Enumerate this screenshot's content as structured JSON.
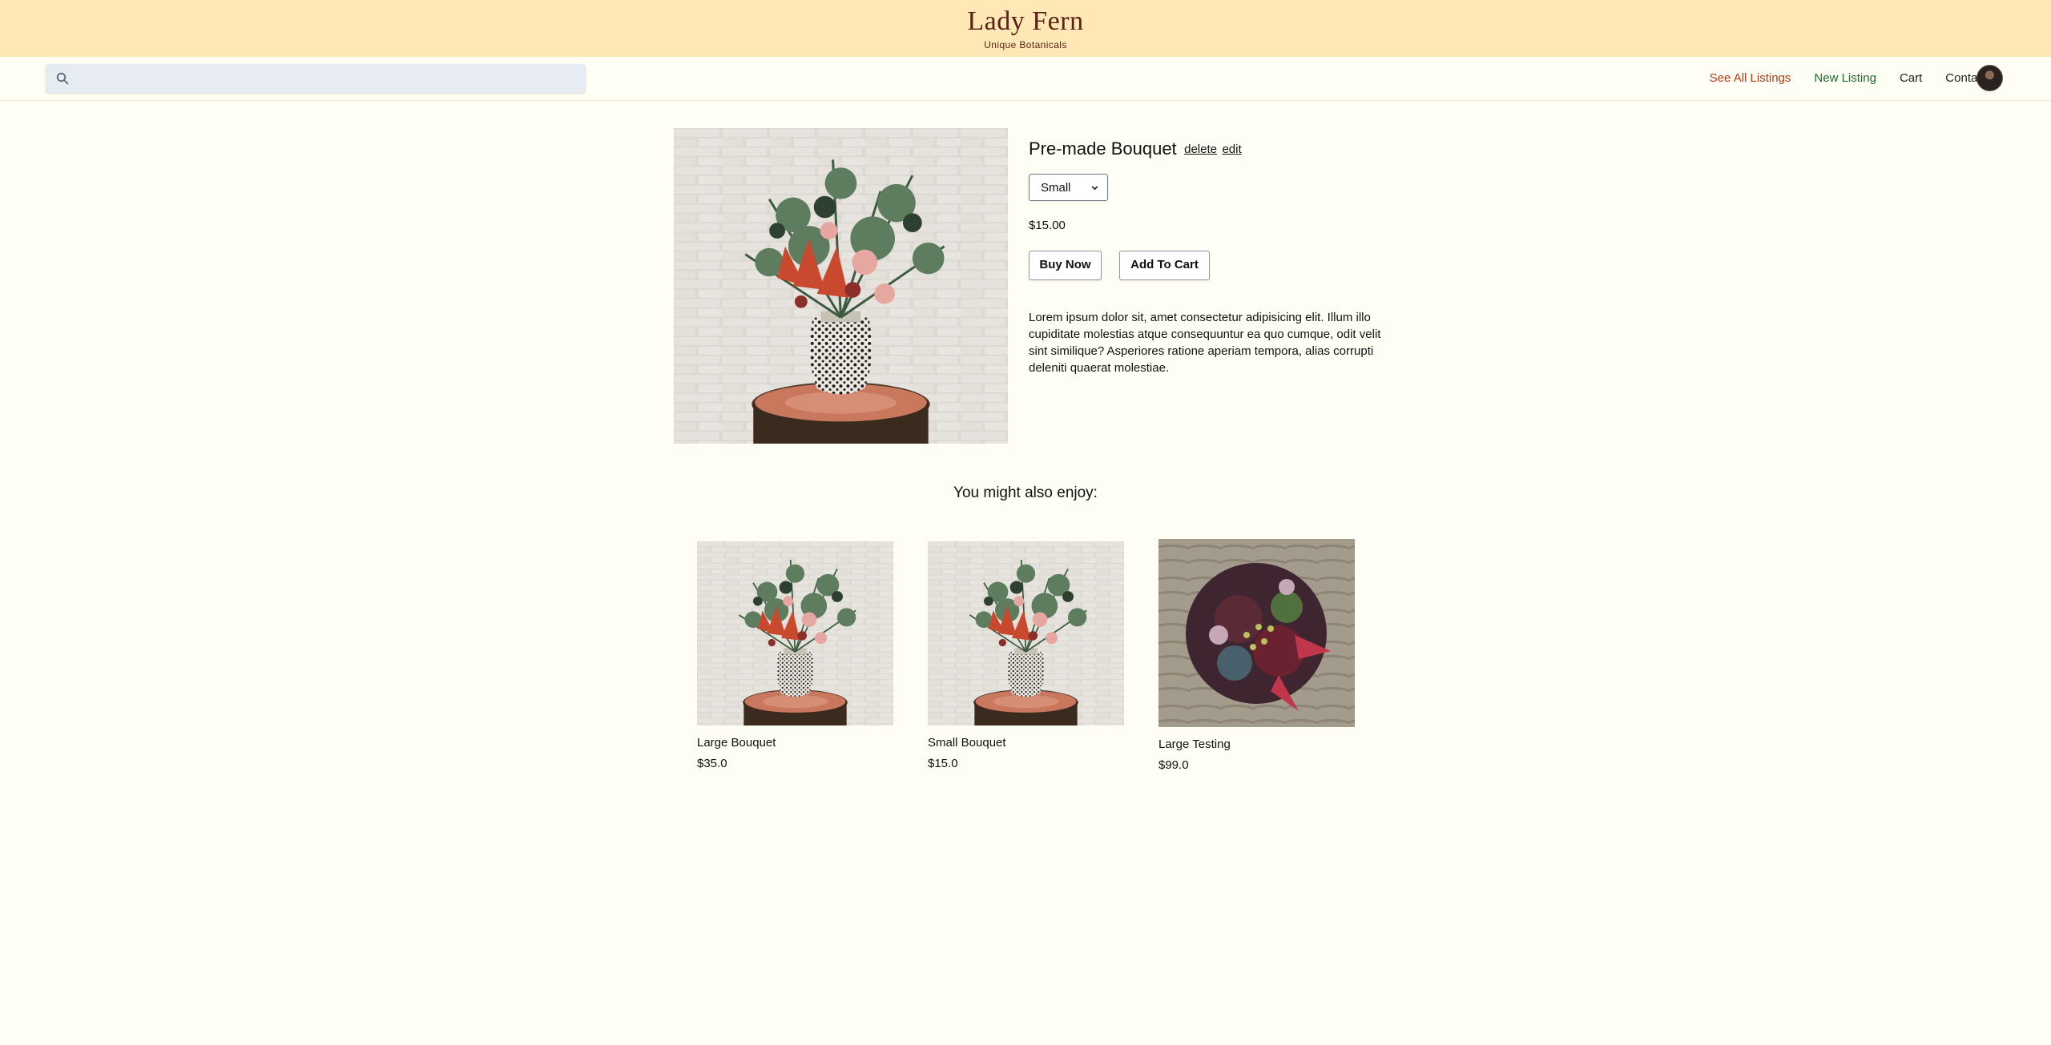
{
  "brand": {
    "title": "Lady Fern",
    "subtitle": "Unique Botanicals"
  },
  "search": {
    "placeholder": "",
    "value": "",
    "icon": "search-icon"
  },
  "nav": {
    "links": [
      {
        "label": "See All Listings",
        "color": "#b33a16"
      },
      {
        "label": "New Listing",
        "color": "#1f6b2b"
      },
      {
        "label": "Cart",
        "color": "#222222"
      },
      {
        "label": "Contact",
        "color": "#222222"
      }
    ],
    "avatar": "user-avatar"
  },
  "product": {
    "title": "Pre-made Bouquet",
    "delete_label": "delete",
    "edit_label": "edit",
    "size_selected": "Small",
    "price": "$15.00",
    "buy_label": "Buy Now",
    "cart_label": "Add To Cart",
    "description": "Lorem ipsum dolor sit, amet consectetur adipisicing elit. Illum illo cupiditate molestias atque consequuntur ea quo cumque, odit velit sint similique? Asperiores ratione aperiam tempora, alias corrupti deleniti quaerat molestiae."
  },
  "recommendations": {
    "heading": "You might also enjoy:",
    "items": [
      {
        "name": "Large Bouquet",
        "price": "$35.0"
      },
      {
        "name": "Small Bouquet",
        "price": "$15.0"
      },
      {
        "name": "Large Testing",
        "price": "$99.0"
      }
    ]
  },
  "colors": {
    "header_bg": "#ffe8b5",
    "page_bg": "#fffef4",
    "brand": "#5a2314"
  }
}
